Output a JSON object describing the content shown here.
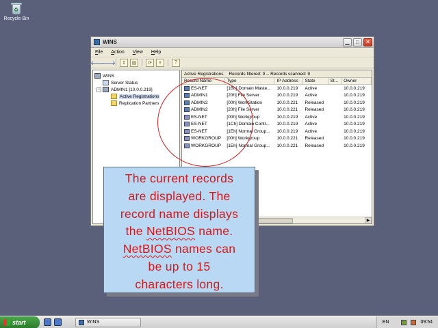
{
  "desktop": {
    "recycle_bin_label": "Recycle Bin"
  },
  "window": {
    "title": "WINS",
    "menu": [
      "File",
      "Action",
      "View",
      "Help"
    ],
    "tree": [
      {
        "label": "WINS",
        "level": 0,
        "icon": "wins-icon"
      },
      {
        "label": "Server Status",
        "level": 1,
        "icon": "server-icon"
      },
      {
        "label": "ADMIN1 [10.0.0.219]",
        "level": 1,
        "icon": "server-icon",
        "expanded": true
      },
      {
        "label": "Active Registrations",
        "level": 2,
        "icon": "folder-icon",
        "selected": true
      },
      {
        "label": "Replication Partners",
        "level": 2,
        "icon": "folder-icon"
      }
    ],
    "list_header": {
      "title": "Active Registrations",
      "summary": "Records filtered: 9 -- Records scanned: 9"
    },
    "columns": [
      "Record Name",
      "Type",
      "IP Address",
      "State",
      "St...",
      "Owner"
    ],
    "records": [
      {
        "name": "ES-NET",
        "type": "[1Bh] Domain Maste...",
        "ip": "10.0.0.219",
        "state": "Active",
        "owner": "10.0.0.219",
        "kind": "unique"
      },
      {
        "name": "ADMIN1",
        "type": "[20h] File Server",
        "ip": "10.0.0.219",
        "state": "Active",
        "owner": "10.0.0.219",
        "kind": "unique"
      },
      {
        "name": "ADMIN2",
        "type": "[00h] WorkStation",
        "ip": "10.0.0.221",
        "state": "Released",
        "owner": "10.0.0.219",
        "kind": "unique"
      },
      {
        "name": "ADMIN2",
        "type": "[20h] File Server",
        "ip": "10.0.0.221",
        "state": "Released",
        "owner": "10.0.0.219",
        "kind": "unique"
      },
      {
        "name": "ES-NET",
        "type": "[00h] Workgroup",
        "ip": "10.0.0.219",
        "state": "Active",
        "owner": "10.0.0.219",
        "kind": "group"
      },
      {
        "name": "ES-NET",
        "type": "[1Ch] Domain Contr...",
        "ip": "10.0.0.219",
        "state": "Active",
        "owner": "10.0.0.219",
        "kind": "group"
      },
      {
        "name": "ES-NET",
        "type": "[1Eh] Normal Group...",
        "ip": "10.0.0.219",
        "state": "Active",
        "owner": "10.0.0.219",
        "kind": "group"
      },
      {
        "name": "WORKGROUP",
        "type": "[00h] Workgroup",
        "ip": "10.0.0.221",
        "state": "Released",
        "owner": "10.0.0.219",
        "kind": "group"
      },
      {
        "name": "WORKGROUP",
        "type": "[1Eh] Normal Group...",
        "ip": "10.0.0.221",
        "state": "Released",
        "owner": "10.0.0.219",
        "kind": "group"
      }
    ]
  },
  "callout": {
    "line1": "The current records",
    "line2": "are displayed. The",
    "line3": "record name displays",
    "line4_pre": "the ",
    "line4_word": "NetBIOS",
    "line4_post": " name.",
    "line5_word": "NetBIOS",
    "line5_post": " names can",
    "line6": "be up to 15",
    "line7": "characters long."
  },
  "taskbar": {
    "start_label": "start",
    "task_label": "WINS",
    "language": "EN",
    "clock": "09:54"
  },
  "colors": {
    "annotation_red": "#d42020",
    "callout_bg": "#b8d8f4",
    "callout_text": "#d81818"
  }
}
